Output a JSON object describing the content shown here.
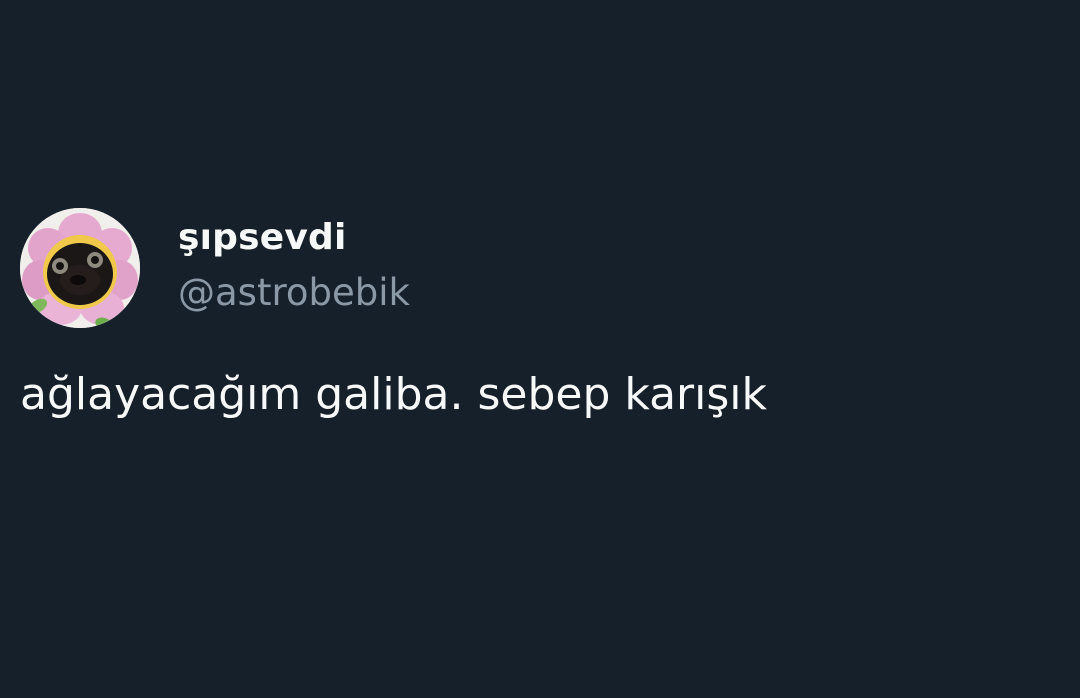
{
  "theme": {
    "background": "#16202a",
    "text_primary": "#f7f9f9",
    "text_secondary": "#8b98a5"
  },
  "tweet": {
    "author": {
      "display_name": "şıpsevdi",
      "handle": "@astrobebik",
      "avatar": {
        "icon": "avatar-pug-in-flower-costume"
      }
    },
    "text": "ağlayacağım galiba. sebep karışık"
  }
}
